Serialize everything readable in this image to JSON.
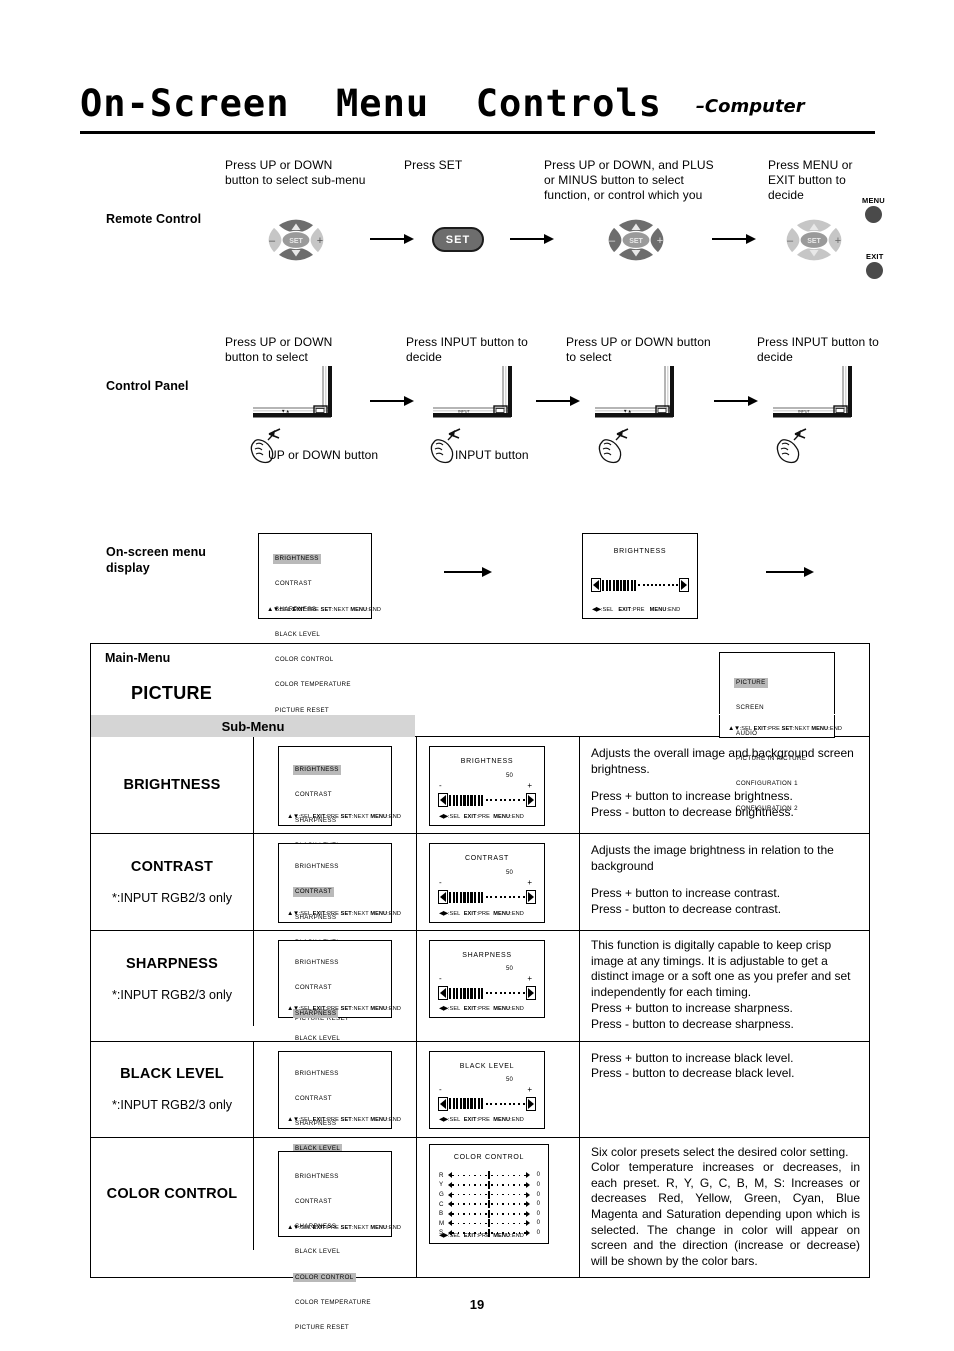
{
  "header": {
    "title": "On-Screen  Menu  Controls",
    "subtitle": "–Computer"
  },
  "sections": {
    "remote_control_label": "Remote Control",
    "control_panel_label": "Control Panel",
    "osd_display_label": "On-screen menu\ndisplay"
  },
  "remote_steps": [
    {
      "caption": "Press UP or DOWN\nbutton to select sub-menu"
    },
    {
      "caption": "Press SET"
    },
    {
      "caption": "Press UP or DOWN, and PLUS\nor MINUS button to select\nfunction, or control which you"
    },
    {
      "caption": "Press MENU or\nEXIT button to\ndecide"
    }
  ],
  "panel_steps": [
    {
      "caption": "Press UP or DOWN\nbutton to select"
    },
    {
      "caption": "Press INPUT button to\ndecide"
    },
    {
      "caption": "Press UP or DOWN button\nto select"
    },
    {
      "caption": "Press INPUT button to\ndecide"
    }
  ],
  "panel_notes": [
    "UP or DOWN button",
    "INPUT button"
  ],
  "remote_buttons": {
    "set": "SET",
    "plus": "+",
    "minus": "–",
    "menu": "MENU",
    "exit": "EXIT"
  },
  "panel_button_labels": {
    "updown": "▼▲",
    "input": "INPUT"
  },
  "osd": {
    "picture_submenu": [
      "BRIGHTNESS",
      "CONTRAST",
      "SHARPNESS",
      "BLACK LEVEL",
      "COLOR CONTROL",
      "COLOR TEMPERATURE",
      "PICTURE RESET"
    ],
    "main_menu": [
      "PICTURE",
      "SCREEN",
      "AUDIO",
      "PICTURE IN PICTURE",
      "CONFIGURATION 1",
      "CONFIGURATION 2"
    ],
    "footer_list": "▲▼:SEL EXIT:PRE SET:NEXT MENU:END",
    "footer_value": "◀▶:SEL  EXIT:PRE  MENU:END",
    "footer_parts_list": {
      "tri": "▲▼",
      "sel": ":SEL ",
      "exit": "EXIT",
      "pre": ":PRE ",
      "set": "SET",
      "next": ":NEXT ",
      "menu": "MENU",
      "end": ":END"
    },
    "value_default": "50",
    "minus": "-",
    "plus": "+"
  },
  "table": {
    "main_menu_label": "Main-Menu",
    "picture_label": "PICTURE",
    "sub_menu_label": "Sub-Menu",
    "input_note": "*:INPUT RGB2/3 only",
    "rows": [
      {
        "name": "BRIGHTNESS",
        "note": "",
        "highlight": "BRIGHTNESS",
        "osd_title": "BRIGHTNESS",
        "value": "50",
        "desc": [
          "Adjusts the overall image and background screen brightness.",
          "Press + button to increase brightness.\nPress - button to decrease brightness."
        ]
      },
      {
        "name": "CONTRAST",
        "note": "*:INPUT RGB2/3 only",
        "highlight": "CONTRAST",
        "osd_title": "CONTRAST",
        "value": "50",
        "desc": [
          "Adjusts the image brightness in relation to the background",
          "Press + button to increase contrast.\nPress - button to decrease contrast."
        ]
      },
      {
        "name": "SHARPNESS",
        "note": "*:INPUT RGB2/3 only",
        "highlight": "SHARPNESS",
        "osd_title": "SHARPNESS",
        "value": "50",
        "desc": [
          "This function is digitally capable to keep crisp image at any timings.  It is adjustable to get a distinct image or a soft one as you prefer and set independently for each timing.",
          "Press + button to increase sharpness.\nPress - button to decrease sharpness."
        ]
      },
      {
        "name": "BLACK LEVEL",
        "note": "*:INPUT RGB2/3 only",
        "highlight": "BLACK LEVEL",
        "osd_title": "BLACK LEVEL",
        "value": "50",
        "desc": [
          "Press + button to increase black level.\nPress - button to decrease black level."
        ]
      },
      {
        "name": "COLOR CONTROL",
        "note": "",
        "highlight": "COLOR CONTROL",
        "osd_title": "COLOR CONTROL",
        "value": "",
        "desc": [
          "Six color presets select the desired color setting.",
          "Color temperature increases or decreases, in each preset. R, Y, G, C, B, M, S:  Increases or decreases Red, Yellow, Green, Cyan, Blue Magenta and Saturation depending upon which is selected.  The change in color will appear on screen and the direction (increase or decrease) will be shown by the color bars."
        ]
      }
    ],
    "color_control_channels": [
      {
        "ch": "R",
        "value": "0"
      },
      {
        "ch": "Y",
        "value": "0"
      },
      {
        "ch": "G",
        "value": "0"
      },
      {
        "ch": "C",
        "value": "0"
      },
      {
        "ch": "B",
        "value": "0"
      },
      {
        "ch": "M",
        "value": "0"
      },
      {
        "ch": "S",
        "value": "0"
      }
    ]
  },
  "footer": {
    "page_number": "19"
  },
  "colors": {
    "highlight_bar": "#b9b9b9",
    "sub_menu_band": "#d5d5d5",
    "pad_dark": "#6d6d6d",
    "pad_light": "#c6c6c6",
    "button_gray": "#4a4a4a"
  }
}
